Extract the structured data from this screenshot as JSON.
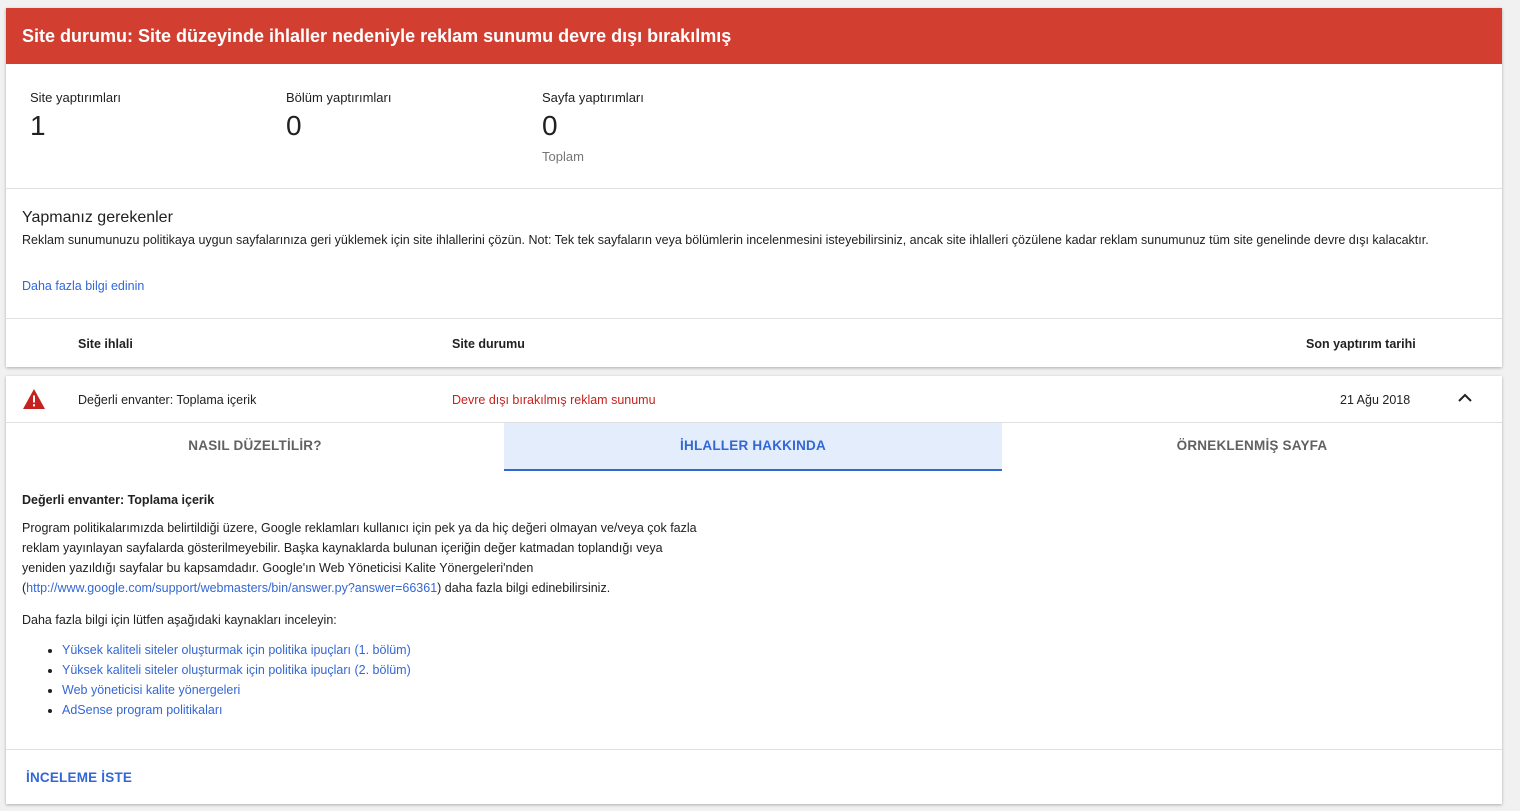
{
  "banner": {
    "title": "Site durumu: Site düzeyinde ihlaller nedeniyle reklam sunumu devre dışı bırakılmış",
    "color": "#d23f31"
  },
  "stats": [
    {
      "label": "Site yaptırımları",
      "value": "1"
    },
    {
      "label": "Bölüm yaptırımları",
      "value": "0"
    },
    {
      "label": "Sayfa yaptırımları",
      "value": "0",
      "sub": "Toplam"
    }
  ],
  "todo": {
    "title": "Yapmanız gerekenler",
    "text": "Reklam sunumunuzu politikaya uygun sayfalarınıza geri yüklemek için site ihlallerini çözün. Not: Tek tek sayfaların veya bölümlerin incelenmesini isteyebilirsiniz, ancak site ihlalleri çözülene kadar reklam sunumunuz tüm site genelinde devre dışı kalacaktır.",
    "learn_more": "Daha fazla bilgi edinin"
  },
  "table": {
    "headers": [
      "Site ihlali",
      "Site durumu",
      "Son yaptırım tarihi"
    ],
    "row": {
      "icon": "warning-icon",
      "violation": "Değerli envanter: Toplama içerik",
      "status": "Devre dışı bırakılmış reklam sunumu",
      "date": "21 Ağu 2018",
      "status_color": "#c5221f"
    }
  },
  "tabs": [
    {
      "label": "NASIL DÜZELTİLİR?"
    },
    {
      "label": "İHLALLER HAKKINDA"
    },
    {
      "label": "ÖRNEKLENMİŞ SAYFA"
    }
  ],
  "detail": {
    "title": "Değerli envanter: Toplama içerik",
    "para1_a": "Program politikalarımızda belirtildiği üzere, Google reklamları kullanıcı için pek ya da hiç değeri olmayan ve/veya çok fazla reklam yayınlayan sayfalarda gösterilmeyebilir. Başka kaynaklarda bulunan içeriğin değer katmadan toplandığı veya yeniden yazıldığı sayfalar bu kapsamdadır. Google'ın Web Yöneticisi Kalite Yönergeleri'nden (",
    "para1_link": "http://www.google.com/support/webmasters/bin/answer.py?answer=66361",
    "para1_b": ") daha fazla bilgi edinebilirsiniz.",
    "para2": "Daha fazla bilgi için lütfen aşağıdaki kaynakları inceleyin:",
    "links": [
      "Yüksek kaliteli siteler oluşturmak için politika ipuçları (1. bölüm)",
      "Yüksek kaliteli siteler oluşturmak için politika ipuçları (2. bölüm)",
      "Web yöneticisi kalite yönergeleri",
      "AdSense program politikaları"
    ]
  },
  "actions": {
    "request_review": "İNCELEME İSTE"
  },
  "colors": {
    "accent": "#3367d6",
    "tab_active_bg": "#e3edfb"
  }
}
